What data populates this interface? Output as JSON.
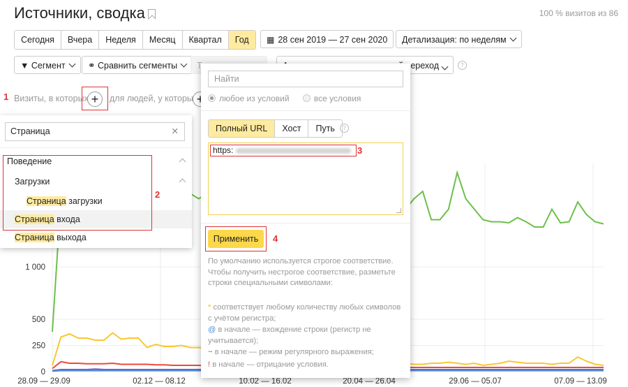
{
  "header": {
    "title": "Источники, сводка",
    "visits": "100 % визитов из 86"
  },
  "period": {
    "tabs": [
      "Сегодня",
      "Вчера",
      "Неделя",
      "Месяц",
      "Квартал",
      "Год"
    ],
    "active": "Год",
    "date_range": "28 сен 2019 — 27 сен 2020",
    "detail": "Детализация: по неделям"
  },
  "toolbar": {
    "segment": "Сегмент",
    "compare": "Сравнить сегменты",
    "partial1": "Т",
    "partial1b": "100%",
    "partial2": "А",
    "partial2b": "й переход"
  },
  "conditions": {
    "visits_label": "Визиты, в которых",
    "users_label": "для людей, у которых",
    "plus": "+"
  },
  "markers": {
    "m1": "1",
    "m2": "2",
    "m3": "3",
    "m4": "4"
  },
  "dropdown": {
    "search_value": "Страница",
    "clear": "✕",
    "group": "Поведение",
    "subgroup": "Загрузки",
    "items": [
      {
        "hl": "Страница",
        "rest": " загрузки"
      },
      {
        "hl": "Страница",
        "rest": " входа"
      },
      {
        "hl": "Страница",
        "rest": " выхода"
      }
    ]
  },
  "popup": {
    "search_placeholder": "Найти",
    "radio_any": "любое из условий",
    "radio_all": "все условия",
    "tabs": [
      "Полный URL",
      "Хост",
      "Путь"
    ],
    "url_value": "https:",
    "apply": "Применить",
    "help_main": "По умолчанию используется строгое соответствие. Чтобы получить нестрогое соответствие, разметьте строки специальными символами:",
    "rules": [
      {
        "sym": "*",
        "text": " соответствует любому количеству любых символов с учётом регистра;",
        "color": "#f2c200"
      },
      {
        "sym": "@",
        "text": " в начале — вхождение строки (регистр не учитывается);",
        "color": "#4a8cd8"
      },
      {
        "sym": "~",
        "text": " в начале — режим регулярного выражения;",
        "color": "#666"
      },
      {
        "sym": "!",
        "text": " в начале — отрицание условия.",
        "color": "#c55"
      }
    ]
  },
  "chart_data": {
    "type": "line",
    "y_ticks": [
      "0",
      "250",
      "500",
      "1 000"
    ],
    "x_labels": [
      "28.09 — 29.09",
      "02.12 — 08.12",
      "10.02 — 16.02",
      "20.04 — 26.04",
      "29.06 — 05.07",
      "07.09 — 13.09"
    ],
    "series": [
      {
        "color": "#6cc04a",
        "values": [
          380,
          1650,
          1700,
          1690,
          1600,
          1720,
          1750,
          1700,
          1650,
          1700,
          1720,
          1680,
          1700,
          1650,
          1700,
          1720,
          1700,
          1650,
          1700,
          1680,
          1700,
          1650,
          1700,
          1720,
          1680,
          1700,
          1650,
          1700,
          1720,
          1700,
          1650,
          1700,
          1680,
          1700,
          1650,
          1700,
          1720,
          1700,
          1650,
          1700,
          1680,
          1550,
          1650,
          1720,
          1450,
          1450,
          1550,
          1900,
          1650,
          1550,
          1450,
          1430,
          1430,
          1420,
          1470,
          1430,
          1380,
          1380,
          1550,
          1420,
          1430,
          1620,
          1500,
          1430,
          1410
        ]
      },
      {
        "color": "#f9c731",
        "values": [
          60,
          330,
          360,
          320,
          320,
          300,
          300,
          370,
          310,
          320,
          320,
          230,
          260,
          240,
          240,
          250,
          230,
          230,
          220,
          240,
          220,
          210,
          200,
          200,
          170,
          180,
          160,
          130,
          140,
          130,
          120,
          110,
          110,
          100,
          90,
          80,
          80,
          70,
          70,
          80,
          70,
          80,
          70,
          70,
          80,
          80,
          90,
          80,
          70,
          80,
          60,
          70,
          80,
          100,
          90,
          80,
          80,
          80,
          70,
          80,
          80,
          140,
          100,
          70,
          60
        ]
      },
      {
        "color": "#ea4b3c",
        "values": [
          30,
          95,
          80,
          80,
          75,
          75,
          75,
          80,
          70,
          70,
          70,
          70,
          65,
          65,
          60,
          60,
          60,
          60,
          55,
          55,
          55,
          50,
          50,
          50,
          50,
          50,
          45,
          45,
          45,
          40,
          40,
          40,
          40,
          40,
          40,
          40,
          40,
          40,
          40,
          40,
          40,
          40,
          40,
          40,
          40,
          40,
          40,
          40,
          40,
          40,
          40,
          40,
          40,
          40,
          40,
          40,
          40,
          40,
          40,
          40,
          40,
          40,
          40,
          40,
          40
        ]
      },
      {
        "color": "#7b5cc4",
        "values": [
          10,
          20,
          20,
          20,
          20,
          25,
          20,
          20,
          20,
          20,
          20,
          20,
          20,
          20,
          20,
          20,
          20,
          20,
          20,
          20,
          20,
          20,
          20,
          20,
          20,
          20,
          20,
          20,
          20,
          20,
          20,
          20,
          20,
          20,
          20,
          20,
          20,
          20,
          20,
          20,
          20,
          20,
          20,
          20,
          20,
          20,
          20,
          20,
          20,
          20,
          20,
          20,
          20,
          20,
          20,
          20,
          20,
          20,
          20,
          20,
          20,
          20,
          20,
          20,
          20
        ]
      },
      {
        "color": "#4a8cd8",
        "values": [
          5,
          10,
          10,
          10,
          10,
          10,
          10,
          10,
          10,
          10,
          10,
          10,
          10,
          10,
          10,
          10,
          10,
          10,
          10,
          10,
          10,
          10,
          10,
          10,
          10,
          10,
          10,
          10,
          10,
          10,
          10,
          10,
          10,
          10,
          10,
          10,
          10,
          10,
          10,
          10,
          10,
          10,
          10,
          10,
          10,
          10,
          10,
          10,
          10,
          10,
          10,
          10,
          10,
          10,
          10,
          10,
          10,
          10,
          10,
          10,
          10,
          10,
          10,
          10,
          10
        ]
      }
    ]
  }
}
